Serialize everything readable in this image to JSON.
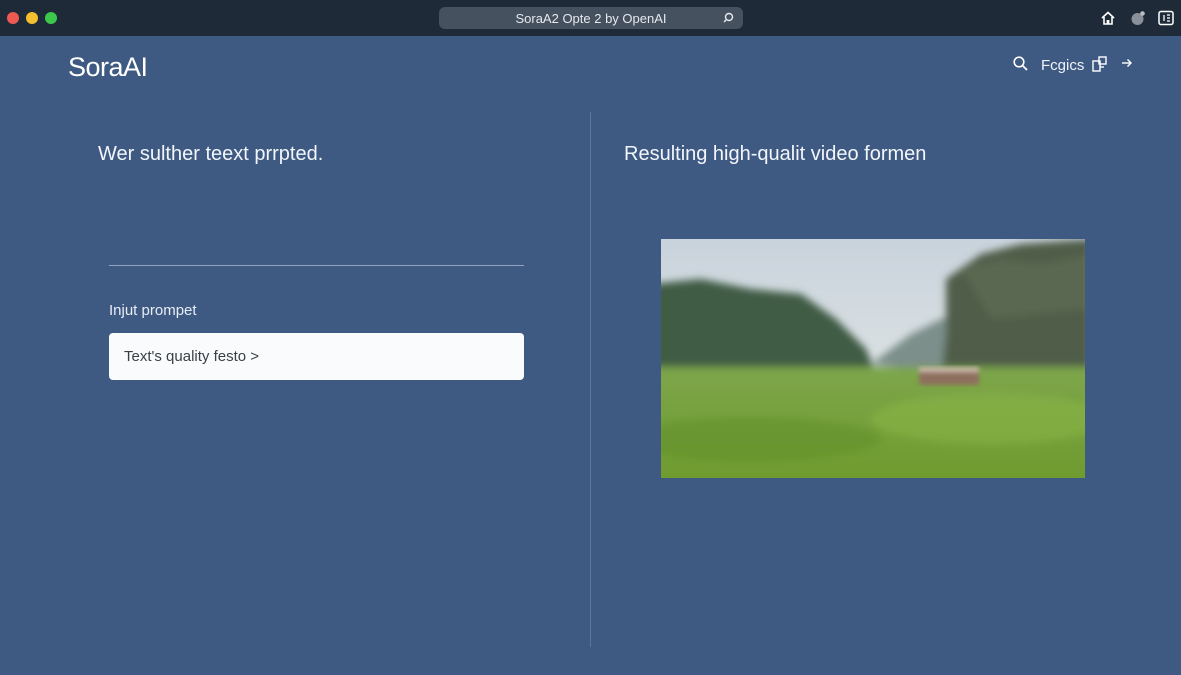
{
  "window": {
    "address_bar_text": "SoraA2 Opte 2 by OpenAI",
    "traffic_lights": {
      "close": "#ee5a52",
      "minimize": "#f4be2e",
      "zoom": "#3cc84a"
    }
  },
  "header": {
    "logo": "SoraAI",
    "nav_link": "Fcgics",
    "icons": [
      "search-icon",
      "external-link-icon",
      "arrow-right-icon"
    ]
  },
  "left_panel": {
    "heading": "Wer sulther teext prrpted.",
    "input_label": "Injut prompet",
    "input_value": "Text's quality festo >"
  },
  "right_panel": {
    "heading": "Resulting high-qualit video formen",
    "video_preview": "landscape-video-thumbnail"
  },
  "colors": {
    "page_background": "#3f5a82",
    "titlebar": "#1e2a38",
    "input_background": "#fafbfc"
  }
}
